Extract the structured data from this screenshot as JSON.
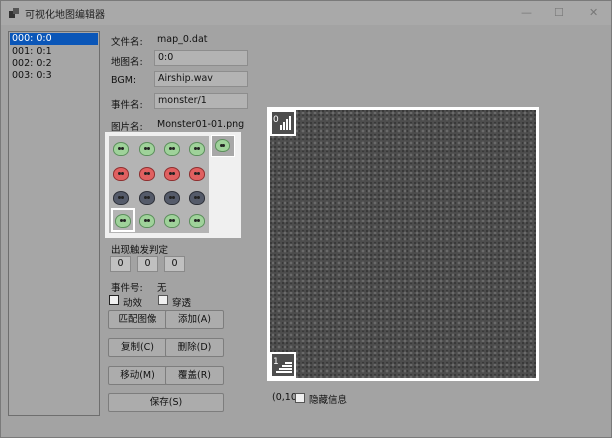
{
  "window": {
    "title": "可视化地图编辑器",
    "controls": [
      "—",
      "☐",
      "✕"
    ]
  },
  "map_list": {
    "items": [
      "000: 0:0",
      "001: 0:1",
      "002: 0:2",
      "003: 0:3"
    ],
    "selected_index": 0
  },
  "form": {
    "file_label": "文件名:",
    "file_value": "map_0.dat",
    "map_name_label": "地图名:",
    "map_name_value": "0:0",
    "bgm_label": "BGM:",
    "bgm_value": "Airship.wav",
    "event_label": "事件名:",
    "event_value": "monster/1",
    "image_label": "图片名:",
    "image_value": "Monster01-01.png",
    "trigger_label": "出现触发判定",
    "trigger_values": [
      "0",
      "0",
      "0"
    ],
    "event_no_label": "事件号:",
    "event_no_value": "无",
    "anim_label": "动效",
    "pass_label": "穿透"
  },
  "buttons": {
    "match_image": "匹配图像",
    "add": "添加(A)",
    "copy": "复制(C)",
    "delete": "删除(D)",
    "move": "移动(M)",
    "overwrite": "覆盖(R)",
    "save": "保存(S)"
  },
  "map_area": {
    "layer_top_label": "0",
    "layer_bottom_label": "1"
  },
  "status": {
    "coords": "(0,10",
    "hide_info_label": "隐藏信息"
  },
  "icons": {
    "app": "app-icon",
    "layer_up": "signal-bars-icon",
    "layer_down": "stairs-icon"
  },
  "colors": {
    "selection": "#0a56b8",
    "window_bg": "#a3a3a3"
  }
}
